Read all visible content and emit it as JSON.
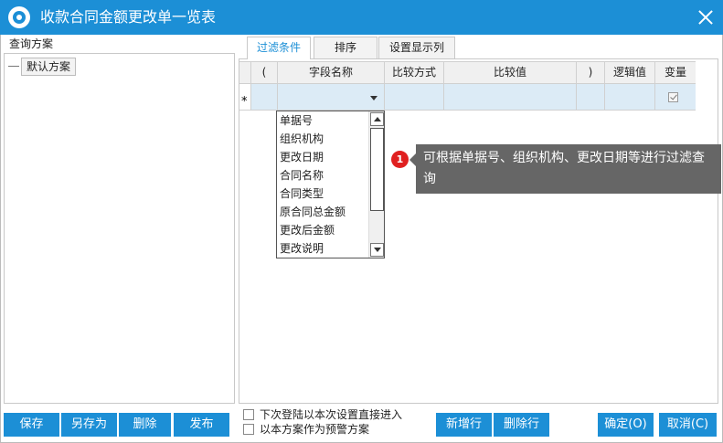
{
  "window": {
    "title": "收款合同金额更改单一览表"
  },
  "left": {
    "label": "查询方案",
    "scheme": "默认方案"
  },
  "tabs": {
    "filter": "过滤条件",
    "sort": "排序",
    "display": "设置显示列"
  },
  "grid": {
    "columns": {
      "lparen": "(",
      "field": "字段名称",
      "op": "比较方式",
      "value": "比较值",
      "rparen": ")",
      "logic": "逻辑值",
      "variable": "变量"
    },
    "row_marker": "*"
  },
  "dropdown": {
    "items": [
      "单据号",
      "组织机构",
      "更改日期",
      "合同名称",
      "合同类型",
      "原合同总金额",
      "更改后金额",
      "更改说明"
    ]
  },
  "callout": {
    "number": "1",
    "text": "可根据单据号、组织机构、更改日期等进行过滤查询"
  },
  "buttons": {
    "save": "保存",
    "save_as": "另存为",
    "delete": "删除",
    "publish": "发布",
    "add_row": "新增行",
    "delete_row": "删除行",
    "ok": "确定(O)",
    "cancel": "取消(C)"
  },
  "options": {
    "next_login": "下次登陆以本次设置直接进入",
    "alert_scheme": "以本方案作为预警方案"
  },
  "colors": {
    "accent": "#1c8fd6",
    "row_highlight": "#dcebf6",
    "callout_bg": "#666666",
    "badge": "#e02020"
  }
}
